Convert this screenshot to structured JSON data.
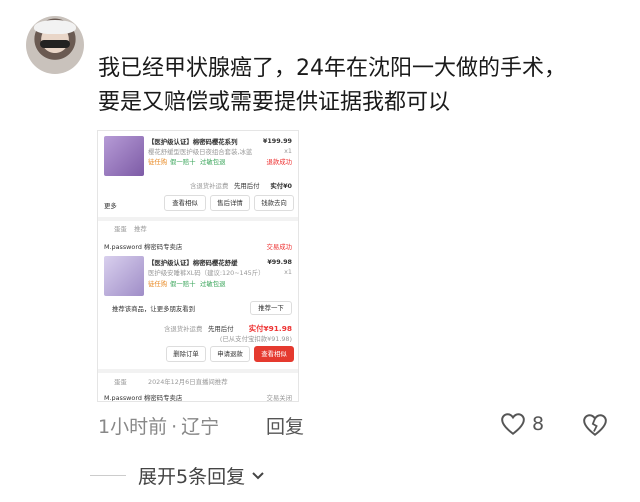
{
  "comment": {
    "line1": "我已经甲状腺癌了，24年在沈阳一大做的手术，",
    "line2": "要是又赔偿或需要提供证据我都可以"
  },
  "order1": {
    "title": "【医护级认证】棉密码樱花系列",
    "price": "¥199.99",
    "subtitle": "樱花舒缓型医护级日夜组合套装,冰蓝",
    "qty": "x1",
    "tags": [
      "徒任购",
      "假一赔十",
      "过敏包退"
    ],
    "status": "退款成功",
    "summary_left": "含退货补运费",
    "summary_mid": "先用后付",
    "summary_pay": "实付¥0",
    "more": "更多",
    "buttons": [
      "查看相似",
      "售后详情",
      "钱款去向"
    ]
  },
  "order2": {
    "user": "蛋蛋",
    "user_tag": "推荐",
    "shop": "M.password 棉密码专卖店",
    "status": "交易成功",
    "title": "【医护级认证】棉密码樱花舒缓",
    "price": "¥99.98",
    "subtitle": "医护级安睡裤XL码（建议:120~145斤）",
    "qty": "x1",
    "tags": [
      "徒任购",
      "假一赔十",
      "过敏包退"
    ],
    "recommend_text": "推荐该商品，让更多朋友看到",
    "recommend_btn": "推荐一下",
    "summary_left": "含退货补运费",
    "summary_mid": "先用后付",
    "summary_pay": "实付¥91.98",
    "paid_note": "(已从支付宝扣款¥91.98)",
    "buttons": [
      "删除订单",
      "申请退款",
      "查看相似"
    ]
  },
  "order3": {
    "user": "蛋蛋",
    "note": "2024年12月6日直播间推荐",
    "shop": "M.password 棉密码专卖店",
    "status": "交易关闭"
  },
  "meta": {
    "time": "1小时前",
    "location": "辽宁",
    "reply": "回复",
    "likes": "8"
  },
  "expand": {
    "label": "展开5条回复"
  },
  "colors": {
    "accent_red": "#e53a2f"
  }
}
